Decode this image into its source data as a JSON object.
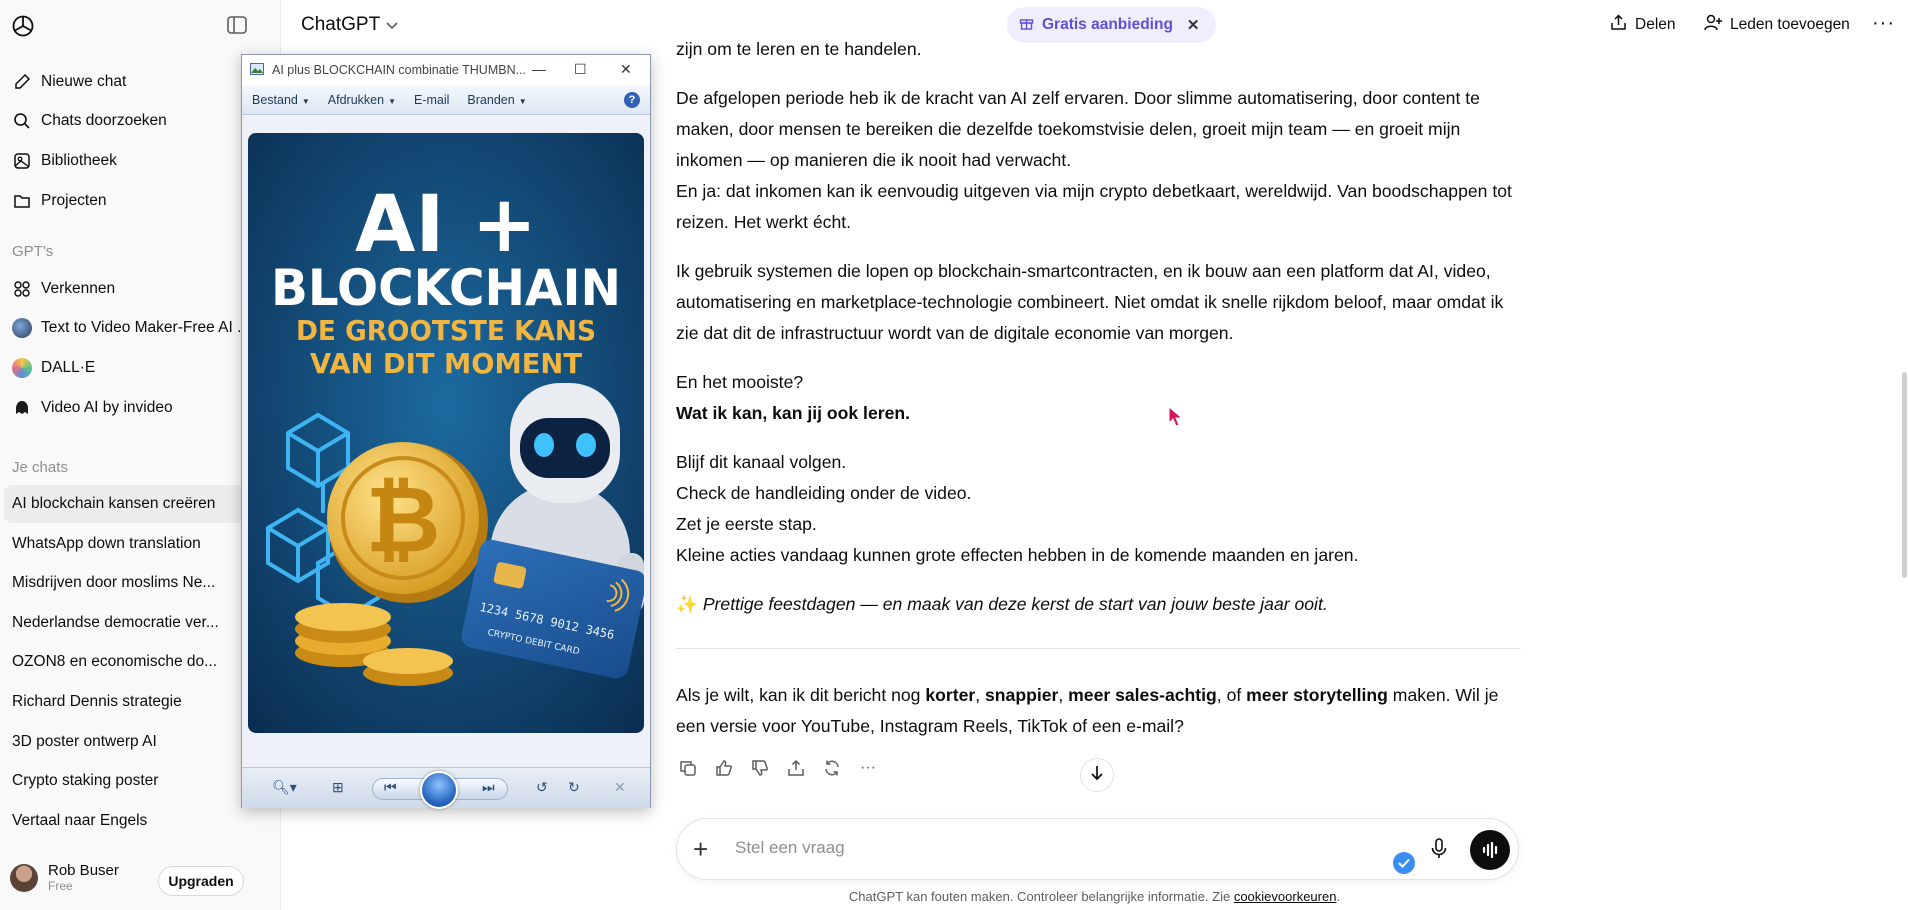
{
  "sidebar": {
    "nav": [
      {
        "label": "Nieuwe chat",
        "icon": "new-chat-icon"
      },
      {
        "label": "Chats doorzoeken",
        "icon": "search-icon"
      },
      {
        "label": "Bibliotheek",
        "icon": "library-icon"
      },
      {
        "label": "Projecten",
        "icon": "folder-icon"
      }
    ],
    "gpts_label": "GPT's",
    "gpts": [
      {
        "label": "Verkennen",
        "icon": "grid-icon"
      },
      {
        "label": "Text to Video Maker-Free AI ...",
        "icon": "gpt-avatar"
      },
      {
        "label": "DALL·E",
        "icon": "gpt-avatar"
      },
      {
        "label": "Video AI by invideo",
        "icon": "gpt-avatar"
      }
    ],
    "chats_label": "Je chats",
    "chats": [
      "AI blockchain kansen creëren",
      "WhatsApp down translation",
      "Misdrijven door moslims Ne...",
      "Nederlandse democratie ver...",
      "OZON8 en economische do...",
      "Richard Dennis strategie",
      "3D poster ontwerp AI",
      "Crypto staking poster",
      "Vertaal naar Engels"
    ],
    "user": {
      "name": "Rob Buser",
      "plan": "Free"
    },
    "upgrade_label": "Upgraden"
  },
  "header": {
    "title": "ChatGPT",
    "promo": "Gratis aanbieding",
    "share": "Delen",
    "add_members": "Leden toevoegen"
  },
  "conversation": {
    "p0": "zijn om te leren en te handelen.",
    "p1": "De afgelopen periode heb ik de kracht van AI zelf ervaren. Door slimme automatisering, door content te maken, door mensen te bereiken die dezelfde toekomstvisie delen, groeit mijn team — en groeit mijn inkomen — op manieren die ik nooit had verwacht.",
    "p1b": "En ja: dat inkomen kan ik eenvoudig uitgeven via mijn crypto debetkaart, wereldwijd. Van boodschappen tot reizen. Het werkt écht.",
    "p2": "Ik gebruik systemen die lopen op blockchain-smartcontracten, en ik bouw aan een platform dat AI, video, automatisering en marketplace-technologie combineert. Niet omdat ik snelle rijkdom beloof, maar omdat ik zie dat dit de infrastructuur wordt van de digitale economie van morgen.",
    "p3a": "En het mooiste?",
    "p3b": "Wat ik kan, kan jij ook leren.",
    "p4": [
      "Blijf dit kanaal volgen.",
      "Check de handleiding onder de video.",
      "Zet je eerste stap.",
      "Kleine acties vandaag kunnen grote effecten hebben in de komende maanden en jaren."
    ],
    "p5": "Prettige feestdagen — en maak van deze kerst de start van jouw beste jaar ooit.",
    "sparkle": "✨",
    "closing_pre": "Als je wilt, kan ik dit bericht nog ",
    "closing_b1": "korter",
    "closing_sep1": ", ",
    "closing_b2": "snappier",
    "closing_sep2": ", ",
    "closing_b3": "meer sales-achtig",
    "closing_mid": ", of ",
    "closing_b4": "meer storytelling",
    "closing_post": " maken. Wil je een versie voor YouTube, Instagram Reels, TikTok of een e-mail?"
  },
  "composer": {
    "placeholder": "Stel een vraag"
  },
  "disclaimer": {
    "text": "ChatGPT kan fouten maken. Controleer belangrijke informatie. Zie ",
    "link": "cookievoorkeuren",
    "end": "."
  },
  "viewer": {
    "title": "AI plus BLOCKCHAIN combinatie THUMBN...",
    "menu": [
      "Bestand",
      "Afdrukken",
      "E-mail",
      "Branden"
    ],
    "poster": {
      "line1": "AI +",
      "line2": "BLOCKCHAIN",
      "line3": "DE GROOTSTE KANS",
      "line4": "VAN DIT MOMENT",
      "card_number": "1234 5678 9012 3456",
      "card_label": "CRYPTO DEBIT CARD"
    }
  },
  "colors": {
    "promo_bg": "#f0eefd",
    "promo_text": "#5d4fd7",
    "poster_bg": "#0f3d66",
    "poster_gold": "#f2b640"
  }
}
